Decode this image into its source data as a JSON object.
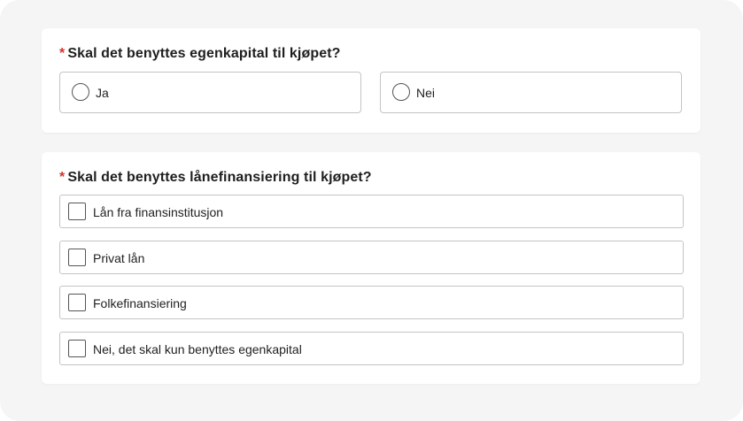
{
  "equity_question": {
    "required_mark": "*",
    "label": "Skal det benyttes egenkapital til kjøpet?",
    "options": [
      {
        "label": "Ja",
        "selected": false
      },
      {
        "label": "Nei",
        "selected": false
      }
    ]
  },
  "financing_question": {
    "required_mark": "*",
    "label": "Skal det benyttes lånefinansiering til kjøpet?",
    "options": [
      {
        "label": "Lån fra finansinstitusjon",
        "checked": false
      },
      {
        "label": "Privat lån",
        "checked": false
      },
      {
        "label": "Folkefinansiering",
        "checked": false
      },
      {
        "label": "Nei, det skal kun benyttes egenkapital",
        "checked": false
      }
    ]
  },
  "colors": {
    "required": "#d4322c",
    "page_background": "#f5f5f5",
    "card_background": "#ffffff",
    "border": "#c4c4c4"
  }
}
